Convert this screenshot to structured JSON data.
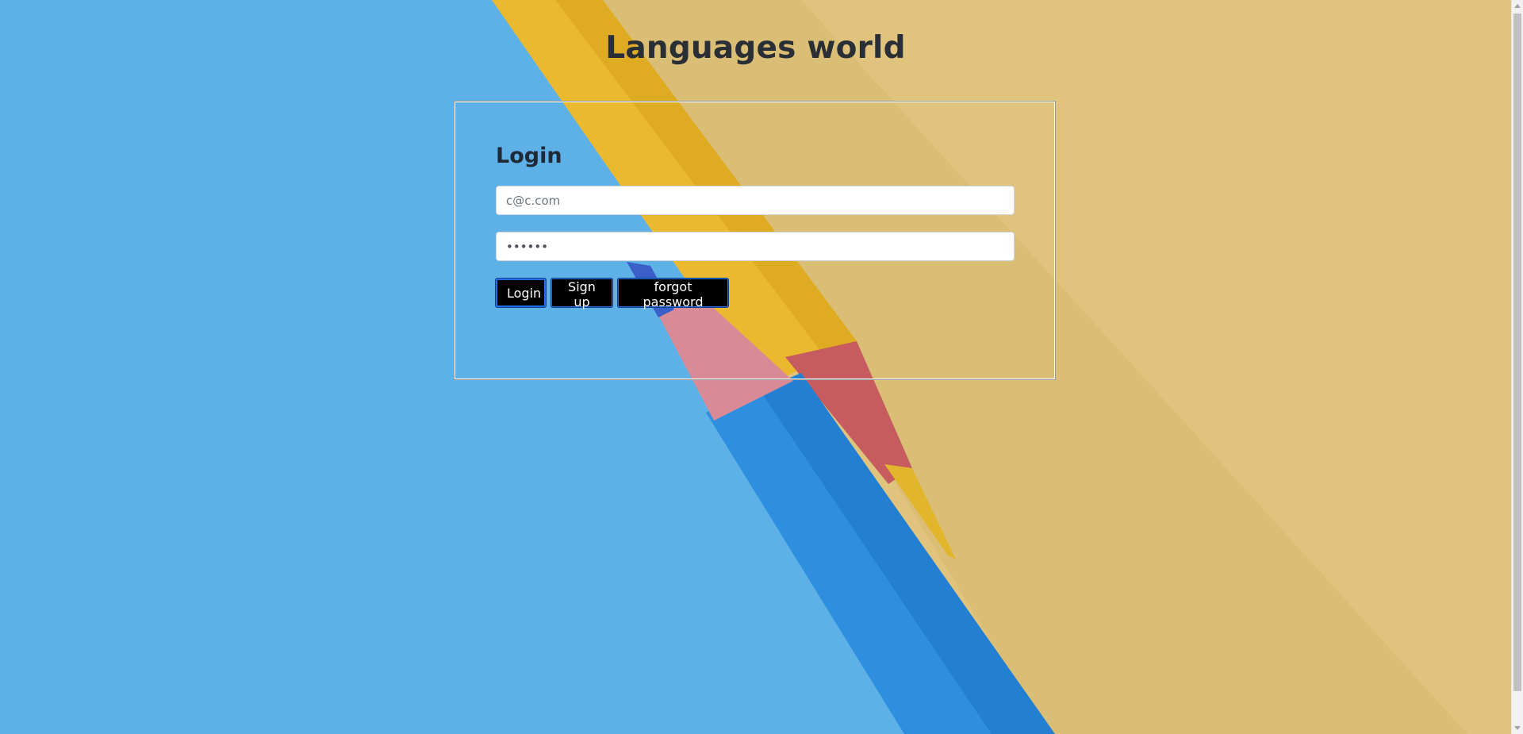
{
  "page": {
    "title": "Languages world"
  },
  "login": {
    "heading": "Login",
    "email": {
      "value": "",
      "placeholder": "c@c.com"
    },
    "password": {
      "value": "123456",
      "placeholder": ""
    },
    "buttons": {
      "login_label": "Login",
      "signup_label": "Sign up",
      "forgot_label": "forgot password"
    }
  },
  "colors": {
    "background_blue": "#5cb0e6",
    "background_yellow": "#e2c57a",
    "button_bg": "#000000",
    "button_border": "#1e6fe8",
    "title_text": "#2a2e35"
  },
  "icons": {
    "background": "pencils-background-image"
  }
}
